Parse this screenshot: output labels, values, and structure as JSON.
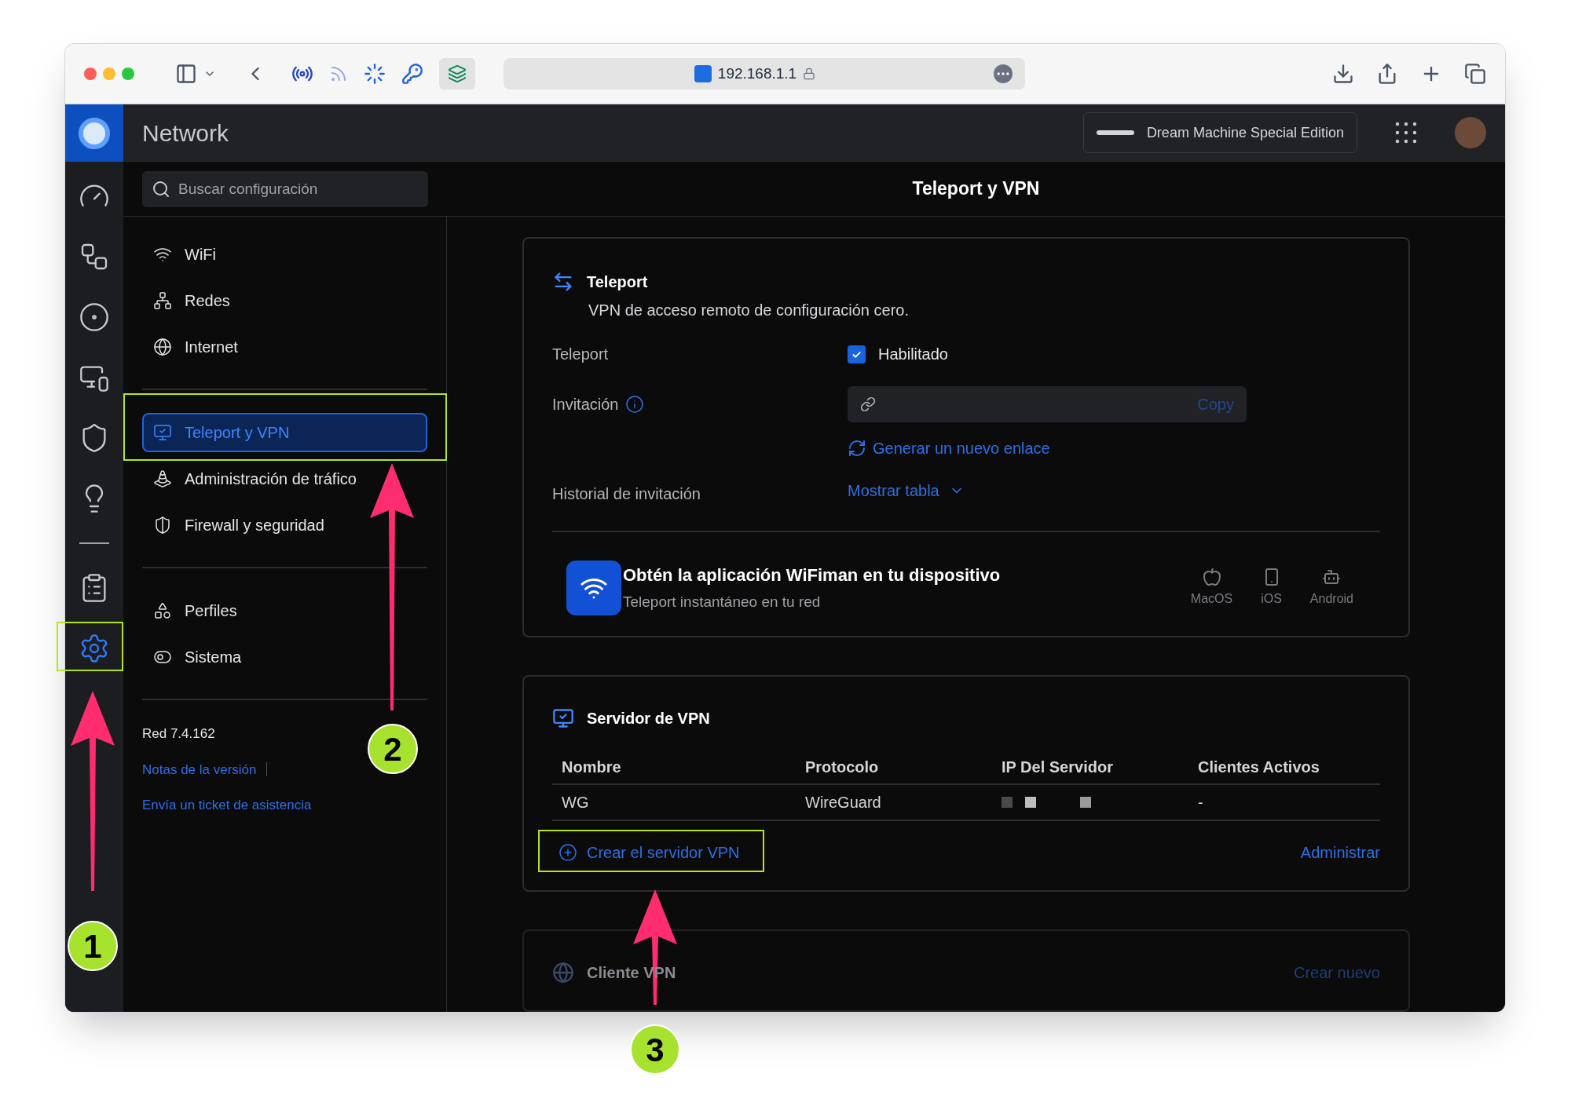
{
  "browser": {
    "url": "192.168.1.1"
  },
  "app": {
    "title": "Network",
    "device": "Dream Machine Special Edition"
  },
  "rail": {
    "top": [
      {
        "selected": false
      },
      {
        "selected": false
      },
      {
        "selected": false
      },
      {
        "selected": false
      },
      {
        "selected": false
      },
      {
        "selected": false
      }
    ],
    "bottom": [
      {
        "selected": false
      },
      {
        "selected": true
      }
    ]
  },
  "search": {
    "placeholder": "Buscar configuración"
  },
  "page_title": "Teleport y VPN",
  "sidebar": {
    "groups": [
      [
        {
          "label": "WiFi",
          "selected": false
        },
        {
          "label": "Redes",
          "selected": false
        },
        {
          "label": "Internet",
          "selected": false
        }
      ],
      [
        {
          "label": "Teleport y VPN",
          "selected": true
        },
        {
          "label": "Administración de tráfico",
          "selected": false
        },
        {
          "label": "Firewall y seguridad",
          "selected": false
        }
      ],
      [
        {
          "label": "Perfiles",
          "selected": false
        },
        {
          "label": "Sistema",
          "selected": false
        }
      ]
    ],
    "version": "Red 7.4.162",
    "links": [
      "Notas de la versión",
      "Envía un ticket de asistencia"
    ]
  },
  "teleport": {
    "title": "Teleport",
    "subtitle": "VPN de acceso remoto de configuración cero.",
    "enable_label": "Teleport",
    "enable": {
      "label": "Habilitado",
      "checked": true
    },
    "invite_label": "Invitación",
    "copy": "Copy",
    "generate": "Generar un nuevo enlace",
    "history_label": "Historial de invitación",
    "show_table": "Mostrar tabla",
    "wifiman": {
      "title": "Obtén la aplicación WiFiman en tu dispositivo",
      "subtitle": "Teleport instantáneo en tu red",
      "platforms": [
        "MacOS",
        "iOS",
        "Android"
      ]
    }
  },
  "vpn_server": {
    "title": "Servidor de VPN",
    "columns": [
      "Nombre",
      "Protocolo",
      "IP Del Servidor",
      "Clientes Activos"
    ],
    "rows": [
      {
        "name": "WG",
        "protocol": "WireGuard",
        "clients": "-"
      }
    ],
    "create": "Crear el servidor VPN",
    "manage": "Administrar"
  },
  "vpn_client": {
    "title": "Cliente VPN",
    "action": "Crear nuevo"
  },
  "annotations": [
    {
      "label": "1"
    },
    {
      "label": "2"
    },
    {
      "label": "3"
    }
  ]
}
